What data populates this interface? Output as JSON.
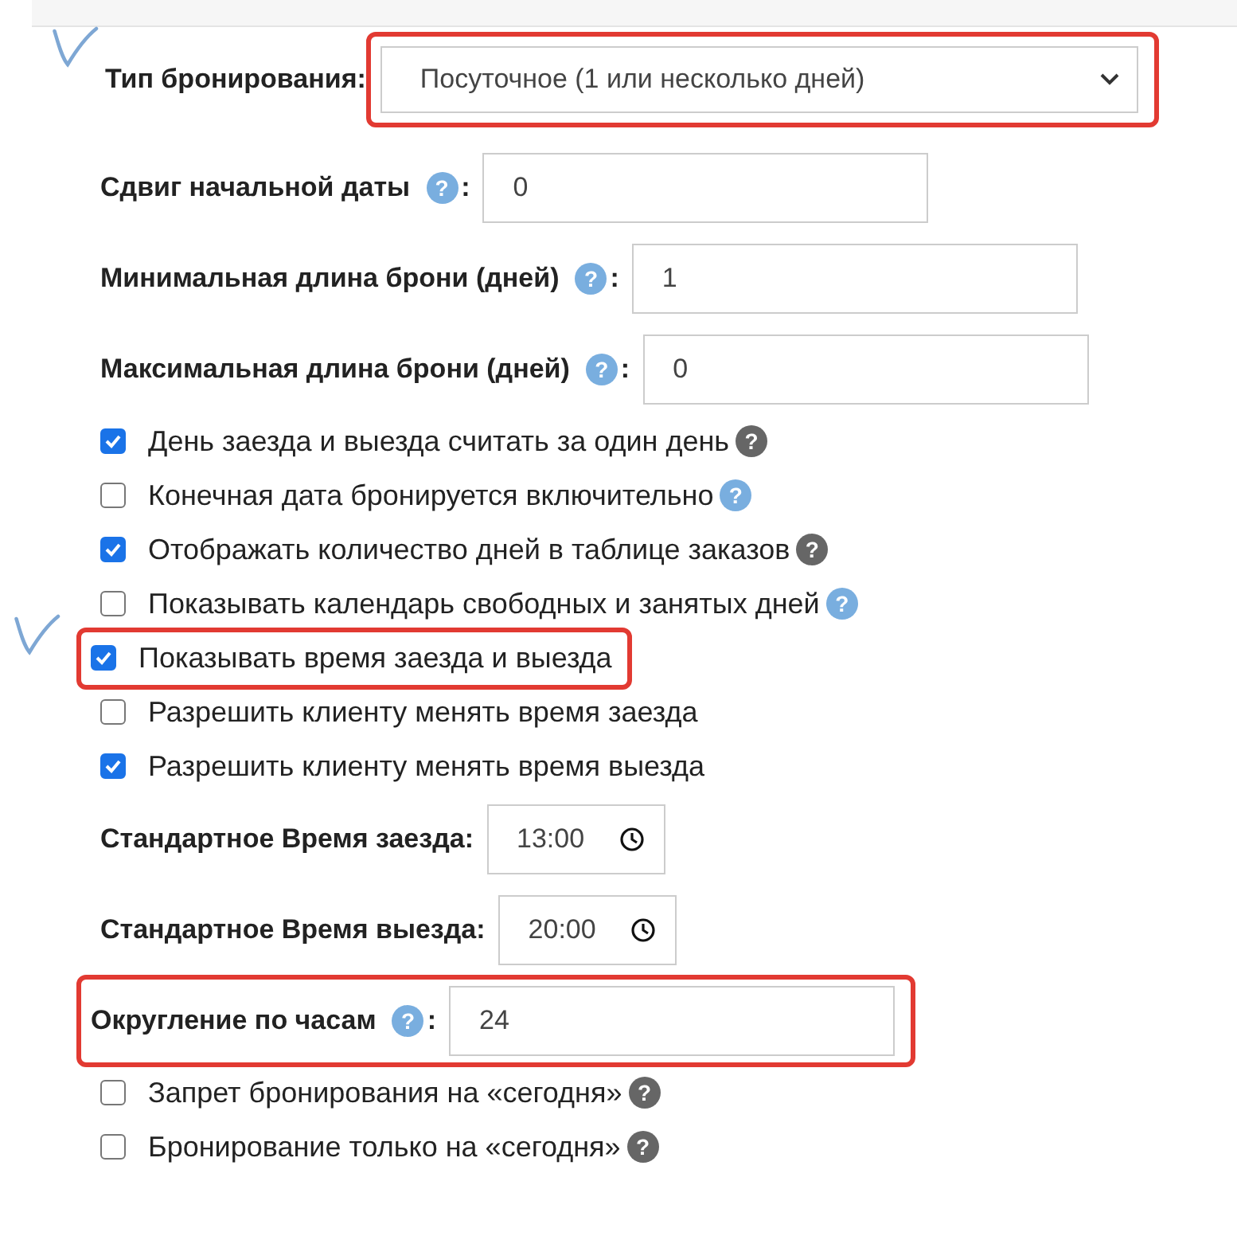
{
  "settings": [
    {
      "kind": "select",
      "label": "Тип бронирования:",
      "value": "Посуточное (1 или несколько дней)",
      "highlighted": true,
      "pen_mark": true
    },
    {
      "kind": "field",
      "label": "Сдвиг начальной даты",
      "help": {
        "mark": "?",
        "dark": false
      },
      "suffix": ":",
      "value": "0",
      "highlighted": false,
      "pen_mark": false
    },
    {
      "kind": "field",
      "label": "Минимальная длина брони (дней)",
      "help": {
        "mark": "?",
        "dark": false
      },
      "suffix": ":",
      "value": "1",
      "highlighted": false,
      "pen_mark": false
    },
    {
      "kind": "field",
      "label": "Максимальная длина брони (дней)",
      "help": {
        "mark": "?",
        "dark": false
      },
      "suffix": ":",
      "value": "0",
      "highlighted": false,
      "pen_mark": false
    },
    {
      "kind": "checkbox",
      "label": "День заезда и выезда считать за один день",
      "checked": true,
      "help": {
        "mark": "?",
        "dark": true
      },
      "highlighted": false,
      "pen_mark": false
    },
    {
      "kind": "checkbox",
      "label": "Конечная дата бронируется включительно",
      "checked": false,
      "help": {
        "mark": "?",
        "dark": false
      },
      "highlighted": false,
      "pen_mark": false
    },
    {
      "kind": "checkbox",
      "label": "Отображать количество дней в таблице заказов",
      "checked": true,
      "help": {
        "mark": "?",
        "dark": true
      },
      "highlighted": false,
      "pen_mark": false
    },
    {
      "kind": "checkbox",
      "label": "Показывать календарь свободных и занятых дней",
      "checked": false,
      "help": {
        "mark": "?",
        "dark": false
      },
      "highlighted": false,
      "pen_mark": false
    },
    {
      "kind": "checkbox",
      "label": "Показывать время заезда и выезда",
      "checked": true,
      "highlighted": true,
      "pen_mark": true
    },
    {
      "kind": "checkbox",
      "label": "Разрешить клиенту менять время заезда",
      "checked": false,
      "highlighted": false,
      "pen_mark": false
    },
    {
      "kind": "checkbox",
      "label": "Разрешить клиенту менять время выезда",
      "checked": true,
      "highlighted": false,
      "pen_mark": false
    },
    {
      "kind": "time",
      "label": "Стандартное Время заезда:",
      "value": "13:00",
      "highlighted": false,
      "pen_mark": false
    },
    {
      "kind": "time",
      "label": "Стандартное Время выезда:",
      "value": "20:00",
      "highlighted": false,
      "pen_mark": false
    },
    {
      "kind": "field",
      "label": "Округление по часам",
      "help": {
        "mark": "?",
        "dark": false
      },
      "suffix": ":",
      "value": "24",
      "highlighted": true,
      "pen_mark": false
    },
    {
      "kind": "checkbox",
      "label": "Запрет бронирования на «сегодня»",
      "checked": false,
      "help": {
        "mark": "?",
        "dark": true
      },
      "highlighted": false,
      "pen_mark": false
    },
    {
      "kind": "checkbox",
      "label": "Бронирование только на «сегодня»",
      "checked": false,
      "help": {
        "mark": "?",
        "dark": true
      },
      "highlighted": false,
      "pen_mark": false
    }
  ]
}
